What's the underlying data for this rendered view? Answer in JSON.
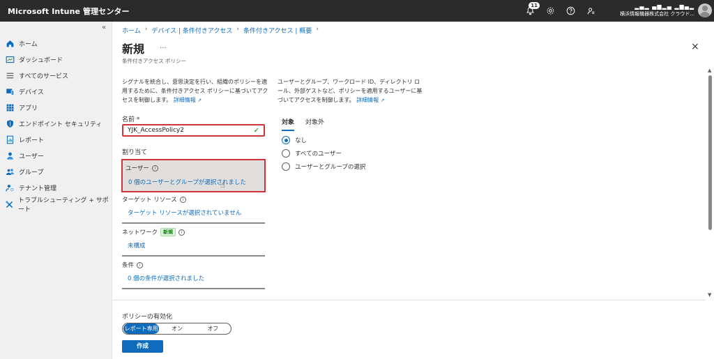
{
  "header": {
    "title": "Microsoft Intune 管理センター",
    "notification_count": "11",
    "account_org": "横浜情報機器株式会社 クラウド..."
  },
  "sidebar": {
    "collapse_glyph": "«",
    "items": [
      {
        "label": "ホーム",
        "icon": "home-icon"
      },
      {
        "label": "ダッシュボード",
        "icon": "dashboard-icon"
      },
      {
        "label": "すべてのサービス",
        "icon": "list-icon"
      },
      {
        "label": "デバイス",
        "icon": "devices-icon"
      },
      {
        "label": "アプリ",
        "icon": "apps-icon"
      },
      {
        "label": "エンドポイント セキュリティ",
        "icon": "shield-icon"
      },
      {
        "label": "レポート",
        "icon": "report-icon"
      },
      {
        "label": "ユーザー",
        "icon": "user-icon"
      },
      {
        "label": "グループ",
        "icon": "group-icon"
      },
      {
        "label": "テナント管理",
        "icon": "tenant-admin-icon"
      },
      {
        "label": "トラブルシューティング + サポート",
        "icon": "troubleshoot-icon"
      }
    ]
  },
  "breadcrumb": [
    "ホーム",
    "デバイス | 条件付きアクセス",
    "条件付きアクセス | 概要"
  ],
  "page": {
    "title": "新規",
    "more": "...",
    "subtitle": "条件付きアクセス ポリシー",
    "close": "×"
  },
  "left_desc": {
    "text": "シグナルを統合し、意思決定を行い、組織のポリシーを適用するために、条件付きアクセス ポリシーに基づいてアクセスを制御します。",
    "link": "詳細情報"
  },
  "right_desc": {
    "text": "ユーザーとグループ、ワークロード ID、ディレクトリ ロール、外部ゲストなど、ポリシーを適用するユーザーに基づいてアクセスを制御します。",
    "link": "詳細情報"
  },
  "form": {
    "name_label": "名前 *",
    "name_value": "YJK_AccessPolicy2",
    "assignments_label": "割り当て",
    "users_label": "ユーザー",
    "users_value": "0 個のユーザーとグループが選択されました",
    "target_label": "ターゲット リソース",
    "target_value": "ターゲット リソースが選択されていません",
    "network_label": "ネットワーク",
    "network_badge": "新規",
    "network_value": "未構成",
    "conditions_label": "条件",
    "conditions_value": "0 個の条件が選択されました"
  },
  "include_panel": {
    "tabs": [
      "対象",
      "対象外"
    ],
    "options": [
      "なし",
      "すべてのユーザー",
      "ユーザーとグループの選択"
    ],
    "selected": "なし"
  },
  "footer": {
    "enable_label": "ポリシーの有効化",
    "toggle_options": [
      "レポート専用",
      "オン",
      "オフ"
    ],
    "toggle_selected": "レポート専用",
    "create_label": "作成"
  },
  "colors": {
    "accent": "#0f6cbd",
    "highlight_border": "#d13438",
    "topbar": "#2b2b2b"
  }
}
